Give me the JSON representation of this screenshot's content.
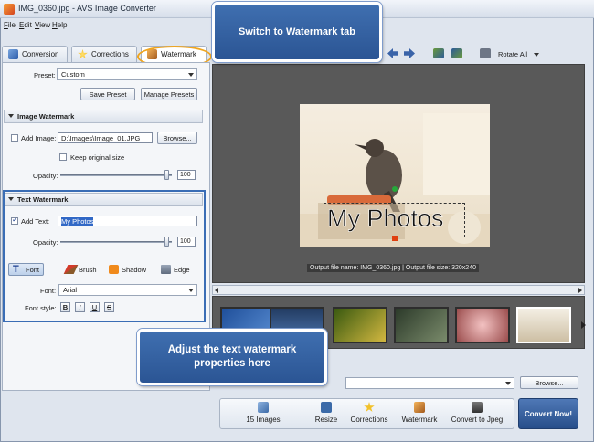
{
  "window": {
    "title": "IMG_0360.jpg - AVS Image Converter"
  },
  "menu": [
    "File",
    "Edit",
    "View",
    "Help"
  ],
  "tabs": [
    {
      "label": "Conversion",
      "icon": "conversion-icon"
    },
    {
      "label": "Corrections",
      "icon": "star-icon"
    },
    {
      "label": "Watermark",
      "icon": "watermark-icon"
    }
  ],
  "preset": {
    "label": "Preset:",
    "value": "Custom",
    "save_label": "Save Preset",
    "manage_label": "Manage Presets"
  },
  "image_watermark": {
    "header": "Image Watermark",
    "add_image_label": "Add Image:",
    "path": "D:\\Images\\Image_01.JPG",
    "browse_label": "Browse...",
    "keep_size_label": "Keep original size",
    "opacity_label": "Opacity:",
    "opacity": "100"
  },
  "text_watermark": {
    "header": "Text Watermark",
    "add_text_label": "Add Text:",
    "text": "My Photos",
    "opacity_label": "Opacity:",
    "opacity": "100",
    "subtabs": [
      "Font",
      "Brush",
      "Shadow",
      "Edge"
    ],
    "font_label": "Font:",
    "font_value": "Arial",
    "font_style_label": "Font style:",
    "styles": [
      "B",
      "I",
      "U",
      "S"
    ]
  },
  "toolbar": {
    "rotate_label": "Rotate All"
  },
  "preview": {
    "watermark_text": "My Photos",
    "output_info": "Output file name: IMG_0360.jpg | Output file size: 320x240"
  },
  "thumbnails": [
    {
      "name": "blue",
      "color": "#2b64b6"
    },
    {
      "name": "sky",
      "color": "#3f6fa8"
    },
    {
      "name": "field",
      "color": "#5c7a1f"
    },
    {
      "name": "dark",
      "color": "#3c4d3a"
    },
    {
      "name": "flowers",
      "color": "#c98d8d"
    },
    {
      "name": "bird",
      "color": "#e9e2d3"
    }
  ],
  "output": {
    "browse_label": "Browse..."
  },
  "steps": [
    {
      "label": "15 Images",
      "icon": "images-icon"
    },
    {
      "label": "Resize",
      "icon": "resize-icon"
    },
    {
      "label": "Corrections",
      "icon": "star-icon"
    },
    {
      "label": "Watermark",
      "icon": "watermark-icon"
    },
    {
      "label": "Convert to Jpeg",
      "icon": "camera-icon"
    }
  ],
  "convert_label": "Convert Now!",
  "callouts": {
    "top": "Switch to Watermark tab",
    "bottom": "Adjust the text watermark properties here"
  },
  "colors": {
    "accent": "#2b5594",
    "callout_border": "#ffffff",
    "highlight": "#3a6db5",
    "tab_circle": "#f0a51e"
  }
}
